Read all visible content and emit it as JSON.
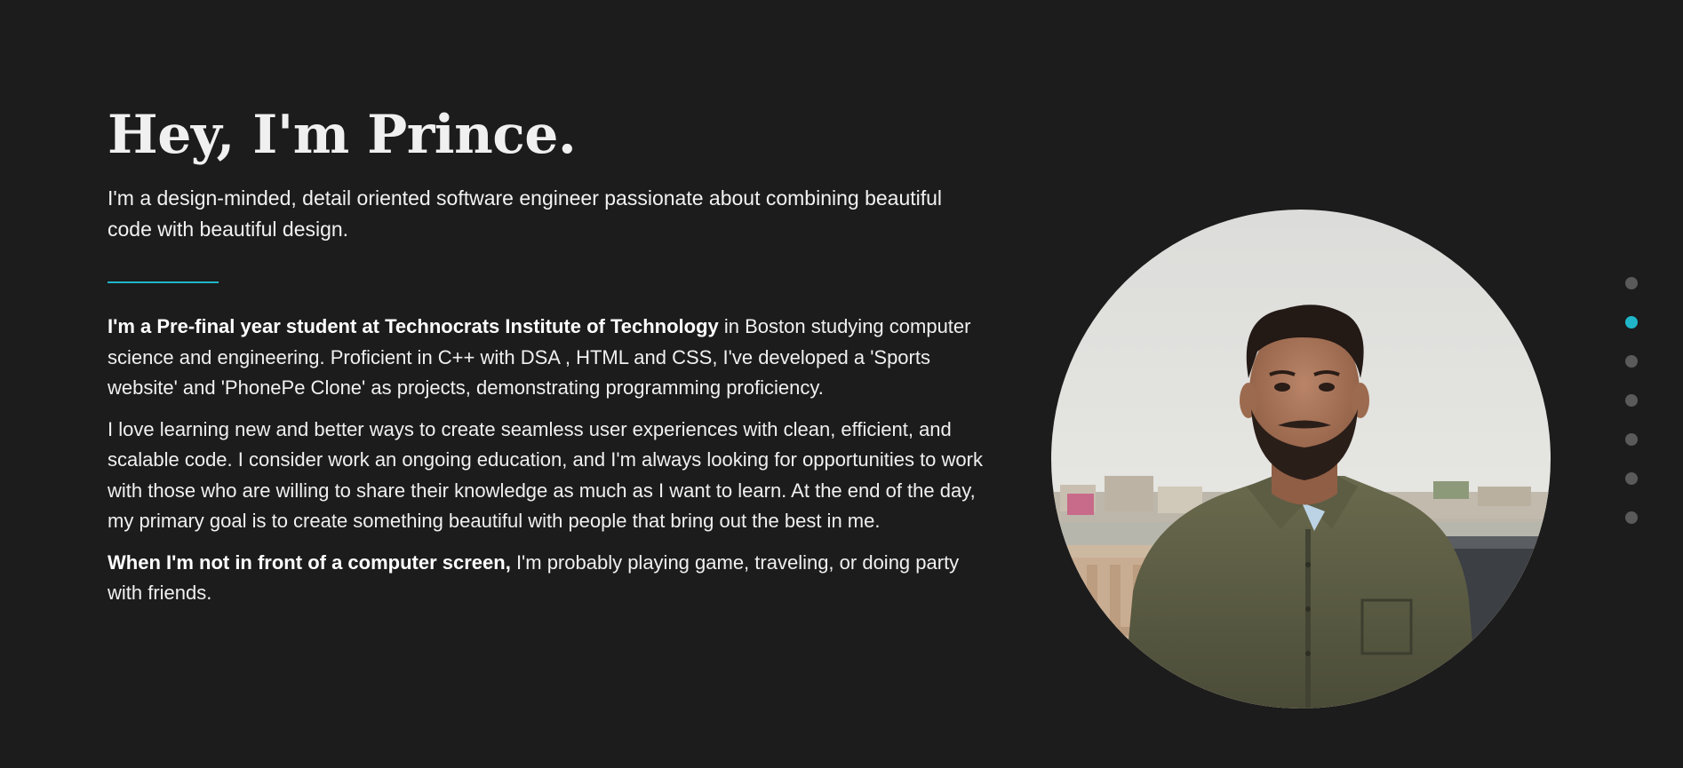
{
  "hero": {
    "title": "Hey, I'm Prince.",
    "subtitle": "I'm a design-minded, detail oriented software engineer passionate about combining beautiful code with beautiful design."
  },
  "bio": {
    "p1_bold": "I'm a Pre-final year student at Technocrats Institute of Technology",
    "p1_rest": " in Boston studying computer science and engineering. Proficient in C++ with DSA , HTML and CSS, I've developed a 'Sports website' and 'PhonePe Clone' as projects, demonstrating programming proficiency.",
    "p2": "I love learning new and better ways to create seamless user experiences with clean, efficient, and scalable code. I consider work an ongoing education, and I'm always looking for opportunities to work with those who are willing to share their knowledge as much as I want to learn. At the end of the day, my primary goal is to create something beautiful with people that bring out the best in me.",
    "p3_bold": "When I'm not in front of a computer screen,",
    "p3_rest": " I'm probably playing game, traveling, or doing party with friends."
  },
  "portrait": {
    "icon": "profile-photo"
  },
  "section_nav": {
    "count": 7,
    "active_index": 1
  },
  "colors": {
    "background": "#1c1c1c",
    "accent": "#1fb6c9",
    "text": "#f2f2f2",
    "inactive_dot": "#5a5a5a"
  }
}
